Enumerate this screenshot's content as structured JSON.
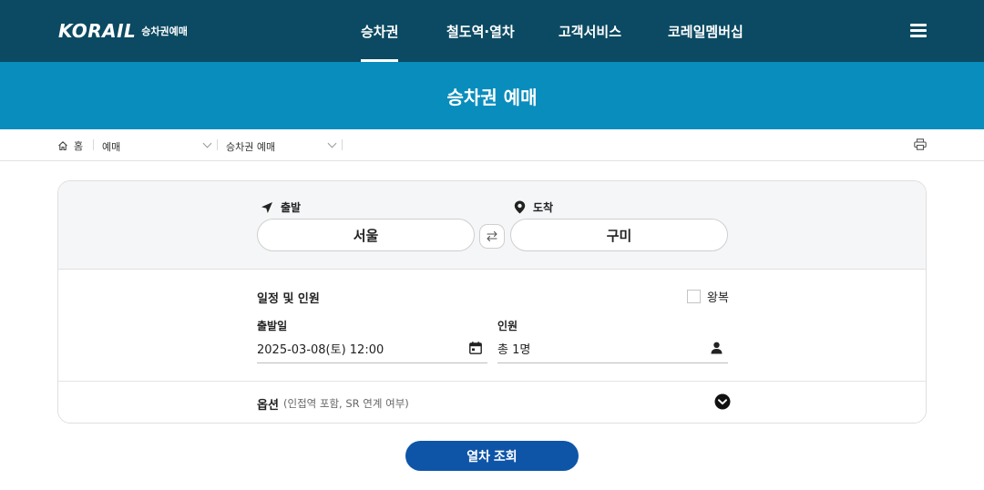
{
  "brand": {
    "logo_text": "KORAIL",
    "logo_sub": "승차권예매"
  },
  "nav": {
    "items": [
      {
        "label": "승차권",
        "active": true
      },
      {
        "label": "철도역·열차",
        "active": false
      },
      {
        "label": "고객서비스",
        "active": false
      },
      {
        "label": "코레일멤버십",
        "active": false
      }
    ],
    "menu_icon": "hamburger-icon"
  },
  "page": {
    "title": "승차권 예매"
  },
  "breadcrumb": {
    "home": "홈",
    "level1": "예매",
    "level2": "승차권 예매",
    "print_icon": "print-icon"
  },
  "search": {
    "departure": {
      "label": "출발",
      "value": "서울",
      "icon": "navigation-arrow-icon"
    },
    "arrival": {
      "label": "도착",
      "value": "구미",
      "icon": "location-pin-icon"
    },
    "swap_icon": "swap-icon",
    "schedule_title": "일정 및 인원",
    "round_trip": {
      "label": "왕복",
      "checked": false
    },
    "date": {
      "label": "출발일",
      "value": "2025-03-08(토) 12:00",
      "icon": "calendar-icon"
    },
    "passengers": {
      "label": "인원",
      "value": "총 1명",
      "icon": "person-icon"
    },
    "options": {
      "title": "옵션",
      "description": "(인접역 포함, SR 연계 여부)",
      "icon": "chevron-down-circle-icon"
    },
    "submit_label": "열차 조회"
  },
  "colors": {
    "topnav": "#0b4a62",
    "banner": "#088dbd",
    "primary_button": "#0e55a8"
  }
}
